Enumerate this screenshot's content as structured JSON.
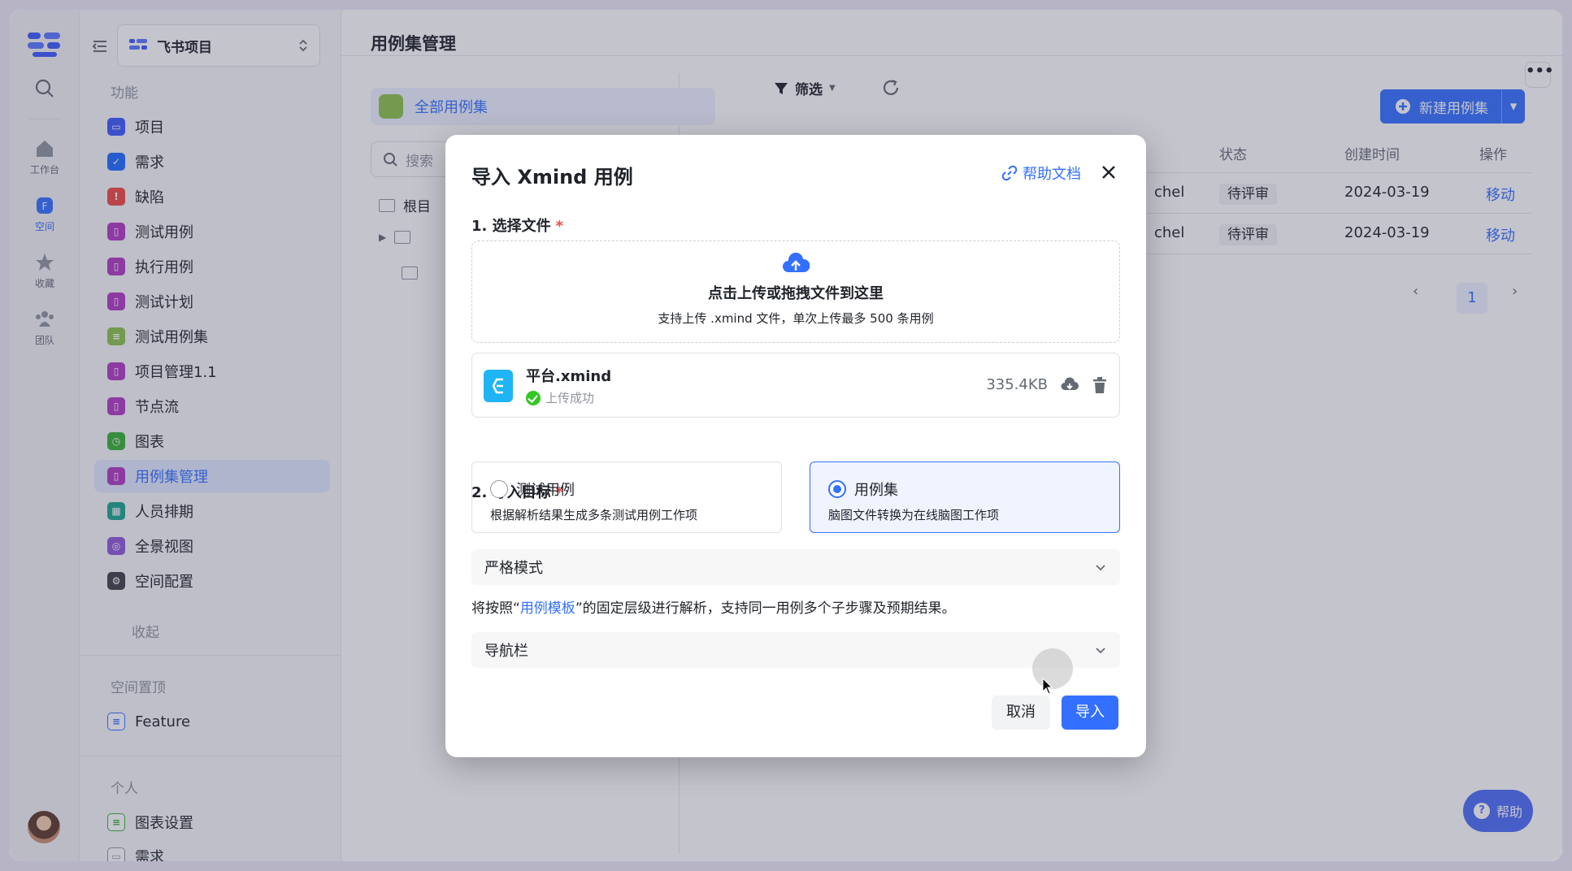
{
  "rail": {
    "items": [
      {
        "label": ""
      },
      {
        "label": "工作台"
      },
      {
        "label": "空间"
      },
      {
        "label": "收藏"
      },
      {
        "label": "团队"
      }
    ]
  },
  "sidebar": {
    "project_name": "飞书项目",
    "section_features": "功能",
    "items": [
      {
        "label": "项目",
        "color": "#3d5afe"
      },
      {
        "label": "需求",
        "color": "#1e6bff"
      },
      {
        "label": "缺陷",
        "color": "#f04844"
      },
      {
        "label": "测试用例",
        "color": "#b03ac2"
      },
      {
        "label": "执行用例",
        "color": "#b03ac2"
      },
      {
        "label": "测试计划",
        "color": "#b03ac2"
      },
      {
        "label": "测试用例集",
        "color": "#8bc34a"
      },
      {
        "label": "项目管理1.1",
        "color": "#b03ac2"
      },
      {
        "label": "节点流",
        "color": "#b03ac2"
      },
      {
        "label": "图表",
        "color": "#34b233"
      },
      {
        "label": "用例集管理",
        "color": "#b03ac2"
      },
      {
        "label": "人员排期",
        "color": "#1aa58c"
      },
      {
        "label": "全景视图",
        "color": "#8e59d8"
      },
      {
        "label": "空间配置",
        "color": "#3e4247"
      }
    ],
    "collapse_label": "收起",
    "section_pinned": "空间置顶",
    "pinned_items": [
      {
        "label": "Feature"
      }
    ],
    "section_personal": "个人",
    "personal_items": [
      {
        "label": "图表设置"
      },
      {
        "label": "需求"
      }
    ]
  },
  "main": {
    "title": "用例集管理",
    "tree_all": "全部用例集",
    "tree_search_placeholder": "搜索",
    "tree_root": "根目",
    "filter_label": "筛选",
    "new_button": "新建用例集",
    "more_label": "•••",
    "columns": [
      "状态",
      "创建时间",
      "操作"
    ],
    "rows": [
      {
        "owner": "chel",
        "status": "待评审",
        "created": "2024-03-19",
        "action": "移动"
      },
      {
        "owner": "chel",
        "status": "待评审",
        "created": "2024-03-19",
        "action": "移动"
      }
    ],
    "page": "1",
    "help_button": "帮助"
  },
  "modal": {
    "title": "导入 Xmind 用例",
    "help_link": "帮助文档",
    "step1_label": "1. 选择文件",
    "required_mark": "*",
    "upload_main": "点击上传或拖拽文件到这里",
    "upload_sub": "支持上传 .xmind 文件，单次上传最多 500 条用例",
    "file": {
      "name": "平台.xmind",
      "status": "上传成功",
      "size": "335.4KB"
    },
    "step2_label": "2. 导入目标",
    "options": [
      {
        "title": "测试用例",
        "desc": "根据解析结果生成多条测试用例工作项",
        "selected": false
      },
      {
        "title": "用例集",
        "desc": "脑图文件转换为在线脑图工作项",
        "selected": true
      }
    ],
    "mode_select": "严格模式",
    "note_prefix": "将按照“",
    "note_link": "用例模板",
    "note_suffix": "”的固定层级进行解析，支持同一用例多个子步骤及预期结果。",
    "nav_select": "导航栏",
    "cancel": "取消",
    "import": "导入"
  }
}
